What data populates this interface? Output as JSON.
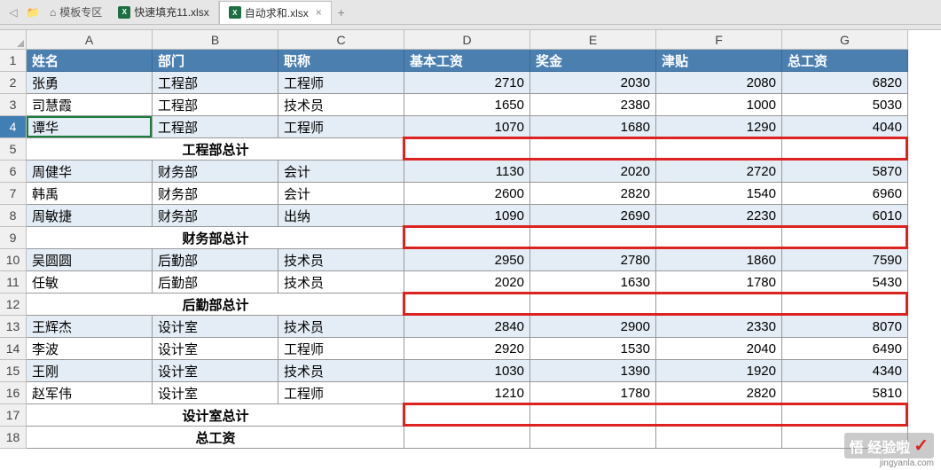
{
  "tabs": {
    "home_label": "模板专区",
    "file1": "快速填充11.xlsx",
    "file2": "自动求和.xlsx"
  },
  "columns": [
    "A",
    "B",
    "C",
    "D",
    "E",
    "F",
    "G"
  ],
  "rows_shown": [
    "1",
    "2",
    "3",
    "4",
    "5",
    "6",
    "7",
    "8",
    "9",
    "10",
    "11",
    "12",
    "13",
    "14",
    "15",
    "16",
    "17",
    "18"
  ],
  "selected_row": "4",
  "table": {
    "headers": {
      "name": "姓名",
      "dept": "部门",
      "title": "职称",
      "base": "基本工资",
      "bonus": "奖金",
      "allowance": "津贴",
      "total": "总工资"
    },
    "subtotal_labels": {
      "eng": "工程部总计",
      "fin": "财务部总计",
      "log": "后勤部总计",
      "des": "设计室总计",
      "grand": "总工资"
    },
    "rows": [
      {
        "r": 2,
        "shade": "lb",
        "name": "张勇",
        "dept": "工程部",
        "title": "工程师",
        "base": "2710",
        "bonus": "2030",
        "allowance": "2080",
        "total": "6820"
      },
      {
        "r": 3,
        "shade": "",
        "name": "司慧霞",
        "dept": "工程部",
        "title": "技术员",
        "base": "1650",
        "bonus": "2380",
        "allowance": "1000",
        "total": "5030"
      },
      {
        "r": 4,
        "shade": "lb",
        "name": "谭华",
        "dept": "工程部",
        "title": "工程师",
        "base": "1070",
        "bonus": "1680",
        "allowance": "1290",
        "total": "4040"
      },
      {
        "r": 6,
        "shade": "lb",
        "name": "周健华",
        "dept": "财务部",
        "title": "会计",
        "base": "1130",
        "bonus": "2020",
        "allowance": "2720",
        "total": "5870"
      },
      {
        "r": 7,
        "shade": "",
        "name": "韩禹",
        "dept": "财务部",
        "title": "会计",
        "base": "2600",
        "bonus": "2820",
        "allowance": "1540",
        "total": "6960"
      },
      {
        "r": 8,
        "shade": "lb",
        "name": "周敏捷",
        "dept": "财务部",
        "title": "出纳",
        "base": "1090",
        "bonus": "2690",
        "allowance": "2230",
        "total": "6010"
      },
      {
        "r": 10,
        "shade": "lb",
        "name": "吴圆圆",
        "dept": "后勤部",
        "title": "技术员",
        "base": "2950",
        "bonus": "2780",
        "allowance": "1860",
        "total": "7590"
      },
      {
        "r": 11,
        "shade": "",
        "name": "任敏",
        "dept": "后勤部",
        "title": "技术员",
        "base": "2020",
        "bonus": "1630",
        "allowance": "1780",
        "total": "5430"
      },
      {
        "r": 13,
        "shade": "lb",
        "name": "王辉杰",
        "dept": "设计室",
        "title": "技术员",
        "base": "2840",
        "bonus": "2900",
        "allowance": "2330",
        "total": "8070"
      },
      {
        "r": 14,
        "shade": "",
        "name": "李波",
        "dept": "设计室",
        "title": "工程师",
        "base": "2920",
        "bonus": "1530",
        "allowance": "2040",
        "total": "6490"
      },
      {
        "r": 15,
        "shade": "lb",
        "name": "王刚",
        "dept": "设计室",
        "title": "技术员",
        "base": "1030",
        "bonus": "1390",
        "allowance": "1920",
        "total": "4340"
      },
      {
        "r": 16,
        "shade": "",
        "name": "赵军伟",
        "dept": "设计室",
        "title": "工程师",
        "base": "1210",
        "bonus": "1780",
        "allowance": "2820",
        "total": "5810"
      }
    ],
    "subtotals": [
      {
        "r": 5,
        "label_key": "eng"
      },
      {
        "r": 9,
        "label_key": "fin"
      },
      {
        "r": 12,
        "label_key": "log"
      },
      {
        "r": 17,
        "label_key": "des"
      },
      {
        "r": 18,
        "label_key": "grand"
      }
    ]
  },
  "highlight_rows": [
    5,
    9,
    12,
    17
  ],
  "watermark": {
    "brand": "悟 经验啦",
    "url": "jingyanla.com"
  }
}
